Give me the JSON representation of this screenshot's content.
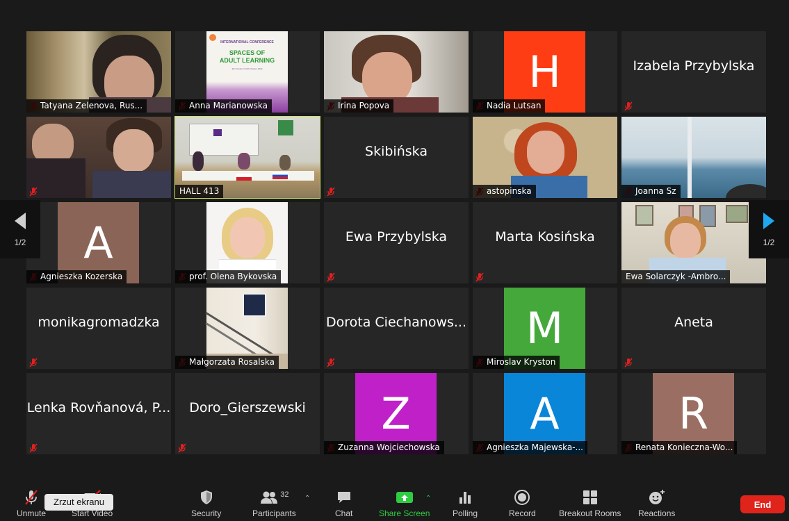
{
  "pager": {
    "left": "1/2",
    "right": "1/2"
  },
  "tiles": {
    "t1": "Tatyana Zelenova, Rus...",
    "t2": "Anna Marianowska",
    "t2_poster_1": "INTERNATIONAL CONFERENCE",
    "t2_poster_2": "SPACES OF",
    "t2_poster_3": "ADULT LEARNING",
    "t2_poster_4": "9th October 10 9th October 2020",
    "t3": "Irina Popova",
    "t4": "Nadia Lutsan",
    "t4_initial": "H",
    "t5_center": "Izabela Przybylska",
    "t7": "HALL 413",
    "t8_center": "Skibińska",
    "t9": "astopinska",
    "t10": "Joanna Sz",
    "t11": "Agnieszka Kozerska",
    "t11_initial": "A",
    "t12": "prof. Olena Bykovska",
    "t13_center": "Ewa Przybylska",
    "t14_center": "Marta Kosińska",
    "t15": "Ewa Solarczyk -Ambro...",
    "t16_center": "monikagromadzka",
    "t17": "Małgorzata Rosalska",
    "t18_center": "Dorota Ciechanows...",
    "t19": "Miroslav Kryston",
    "t19_initial": "M",
    "t20_center": "Aneta",
    "t21_center": "Lenka Rovňanová, P...",
    "t22_center": "Doro_Gierszewski",
    "t23": "Zuzanna Wojciechowska",
    "t23_initial": "Z",
    "t24": "Agnieszka Majewska-...",
    "t24_initial": "A",
    "t25": "Renata Konieczna-Wo...",
    "t25_initial": "R"
  },
  "colors": {
    "avatar_h": "#ff3d14",
    "avatar_a1": "#8b6458",
    "avatar_m": "#45a83b",
    "avatar_z": "#c020c8",
    "avatar_a2": "#0a86d8",
    "avatar_r": "#9a6e62",
    "active_border": "#c9e265",
    "end": "#e0241b"
  },
  "toolbar": {
    "unmute": "Unmute",
    "start_video": "Start Video",
    "security": "Security",
    "participants": "Participants",
    "participants_count": "32",
    "chat": "Chat",
    "share_screen": "Share Screen",
    "polling": "Polling",
    "record": "Record",
    "breakout_rooms": "Breakout Rooms",
    "reactions": "Reactions",
    "end": "End"
  },
  "tooltip": "Zrzut ekranu"
}
